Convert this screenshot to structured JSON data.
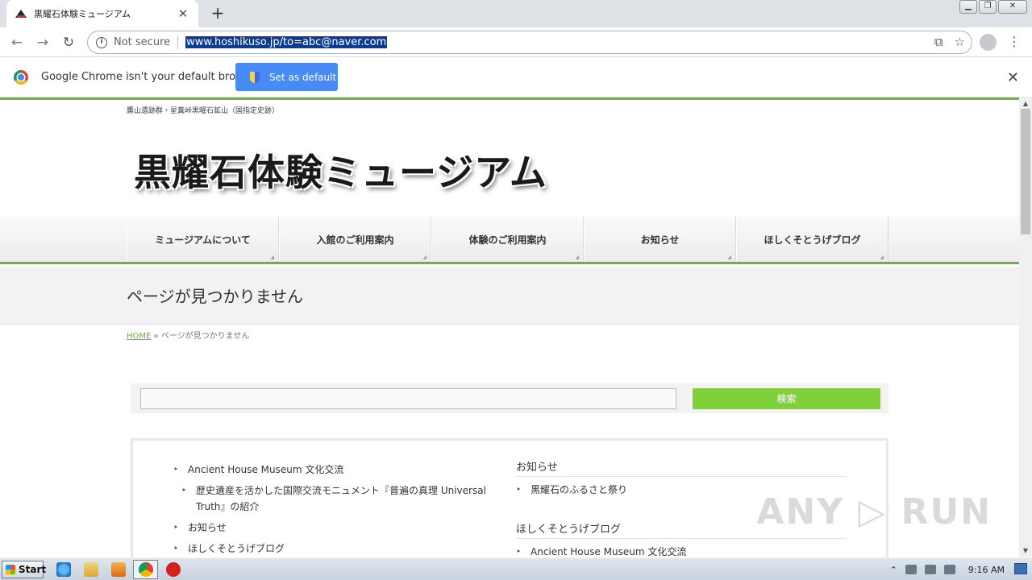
{
  "browser": {
    "tab_title": "黒耀石体験ミュージアム",
    "tab_close": "✕",
    "new_tab": "+",
    "url": "www.hoshikuso.jp/to=abc@naver.com",
    "security_label": "Not secure",
    "infobar_text": "Google Chrome isn't your default browser",
    "set_default_label": "Set as default"
  },
  "site": {
    "tagline": "鷹山遺跡群・星糞峠黒曜石鉱山（国指定史跡）",
    "logo_text": "黒耀石体験ミュージアム",
    "nav": [
      {
        "label": "ミュージアムについて"
      },
      {
        "label": "入館のご利用案内"
      },
      {
        "label": "体験のご利用案内"
      },
      {
        "label": "お知らせ"
      },
      {
        "label": "ほしくそとうげブログ"
      }
    ],
    "page_title": "ページが見つかりません",
    "breadcrumb": {
      "home": "HOME",
      "sep": "»",
      "current": "ページが見つかりません"
    },
    "search": {
      "button": "検索",
      "value": ""
    },
    "left_list": [
      {
        "label": "Ancient House Museum 文化交流",
        "sub": false
      },
      {
        "label": "歴史遺産を活かした国際交流モニュメント『普遍の真理 Universal Truth』の紹介",
        "sub": true
      },
      {
        "label": "お知らせ",
        "sub": false
      },
      {
        "label": "ほしくそとうげブログ",
        "sub": false
      }
    ],
    "right_widgets": [
      {
        "title": "お知らせ",
        "items": [
          "黒耀石のふるさと祭り"
        ]
      },
      {
        "title": "ほしくそとうげブログ",
        "items": [
          "Ancient House Museum 文化交流"
        ]
      }
    ]
  },
  "watermark": "ANY ▷ RUN",
  "taskbar": {
    "start_label": "Start",
    "clock": "9:16 AM"
  }
}
